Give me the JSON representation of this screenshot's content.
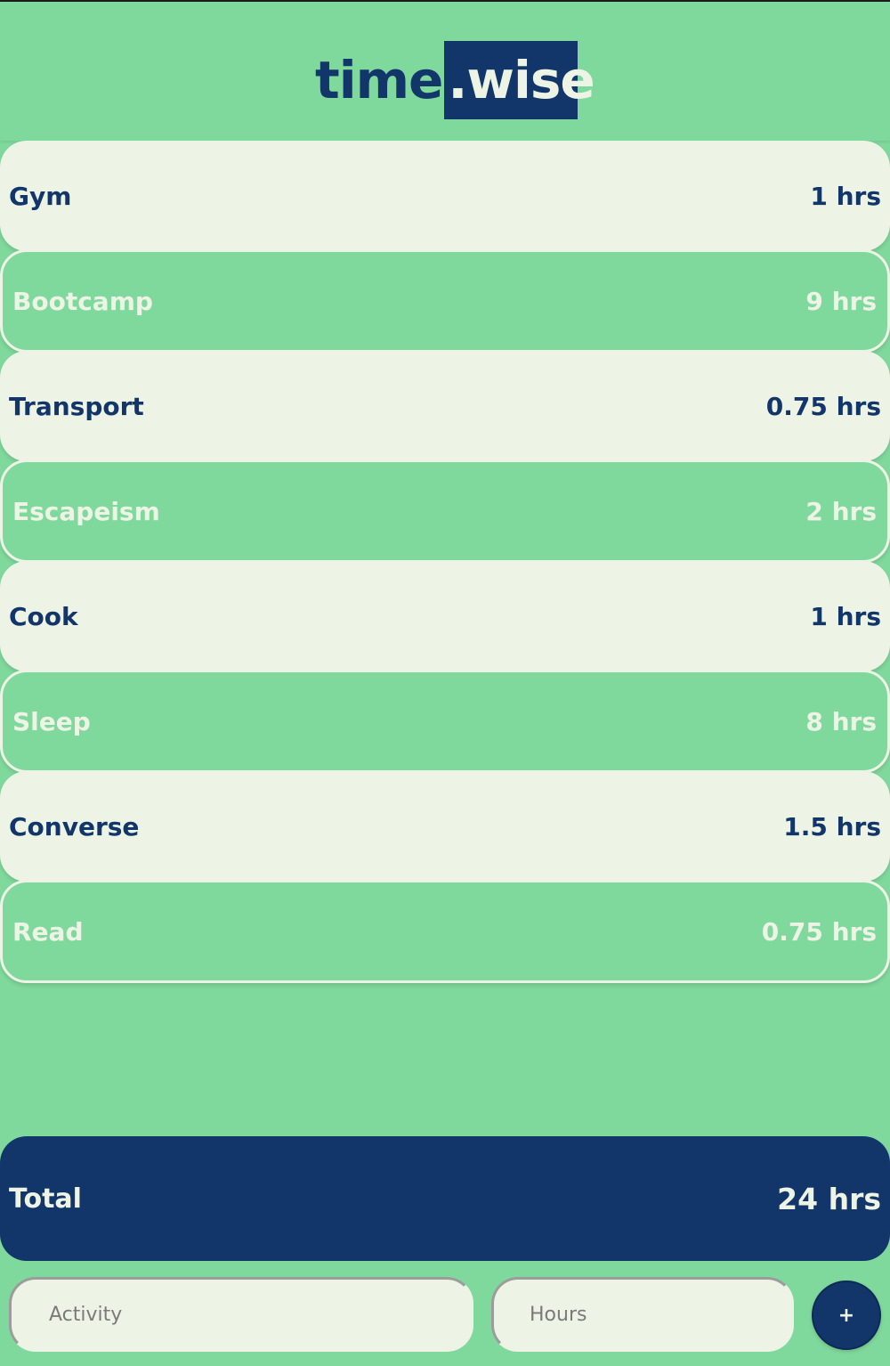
{
  "header": {
    "logo_part1": "time",
    "logo_part2": ".wise"
  },
  "activities": [
    {
      "name": "Gym",
      "hours": "1 hrs"
    },
    {
      "name": "Bootcamp",
      "hours": "9 hrs"
    },
    {
      "name": "Transport",
      "hours": "0.75 hrs"
    },
    {
      "name": "Escapeism",
      "hours": "2 hrs"
    },
    {
      "name": "Cook",
      "hours": "1 hrs"
    },
    {
      "name": "Sleep",
      "hours": "8 hrs"
    },
    {
      "name": "Converse",
      "hours": "1.5 hrs"
    },
    {
      "name": "Read",
      "hours": "0.75 hrs"
    }
  ],
  "total": {
    "label": "Total",
    "value": "24 hrs"
  },
  "form": {
    "activity_placeholder": "Activity",
    "hours_placeholder": "Hours",
    "add_label": "+"
  },
  "colors": {
    "background": "#80d99c",
    "navy": "#13366a",
    "cream": "#edf4e5"
  }
}
